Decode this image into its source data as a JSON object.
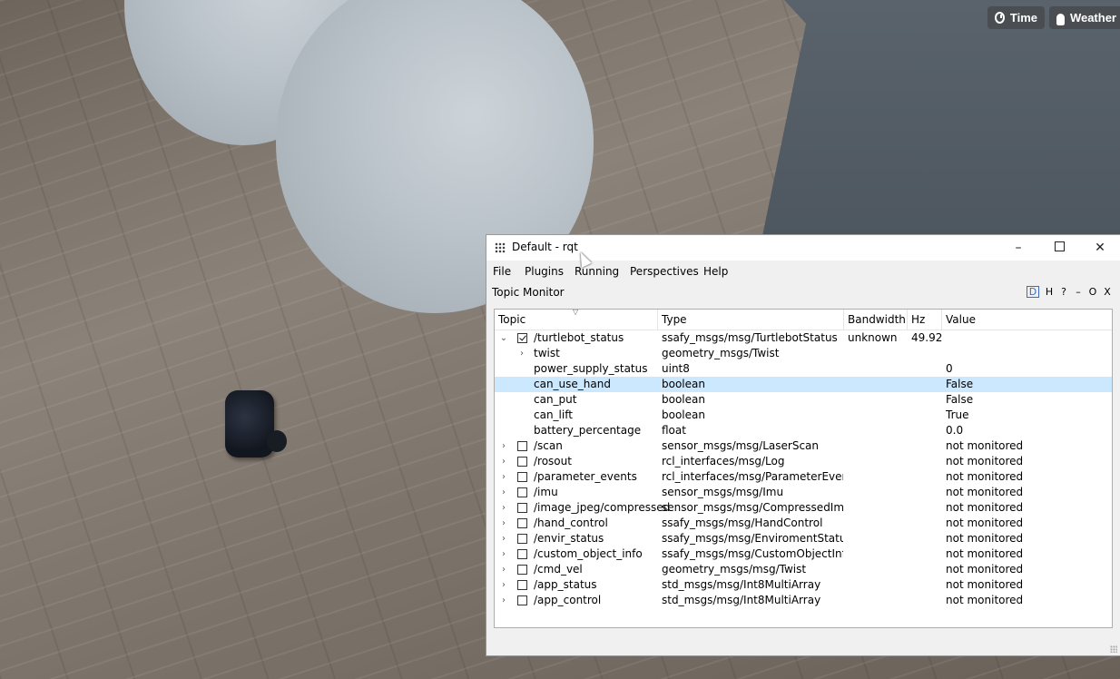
{
  "scene": {
    "buttons": [
      {
        "label": "Time",
        "icon": "clock-icon"
      },
      {
        "label": "Weather",
        "icon": "cloud-icon"
      }
    ]
  },
  "window": {
    "title": "Default - rqt",
    "controls": {
      "minimize": "–",
      "maximize": "",
      "close": "✕"
    }
  },
  "menubar": [
    "File",
    "Plugins",
    "Running",
    "Perspectives",
    "Help"
  ],
  "plugin": {
    "title": "Topic Monitor",
    "controls": [
      "D",
      "H",
      "?",
      "–",
      "O",
      "X"
    ]
  },
  "table": {
    "headers": {
      "topic": "Topic",
      "type": "Type",
      "bandwidth": "Bandwidth",
      "hz": "Hz",
      "value": "Value"
    },
    "rows": [
      {
        "level": 0,
        "expanded": true,
        "checked": true,
        "name": "/turtlebot_status",
        "type": "ssafy_msgs/msg/TurtlebotStatus",
        "bandwidth": "unknown",
        "hz": "49.92",
        "value": ""
      },
      {
        "level": 1,
        "expandable": true,
        "name": "twist",
        "type": "geometry_msgs/Twist",
        "value": ""
      },
      {
        "level": 1,
        "name": "power_supply_status",
        "type": "uint8",
        "value": "0"
      },
      {
        "level": 1,
        "name": "can_use_hand",
        "type": "boolean",
        "value": "False",
        "selected": true
      },
      {
        "level": 1,
        "name": "can_put",
        "type": "boolean",
        "value": "False"
      },
      {
        "level": 1,
        "name": "can_lift",
        "type": "boolean",
        "value": "True"
      },
      {
        "level": 1,
        "name": "battery_percentage",
        "type": "float",
        "value": "0.0"
      },
      {
        "level": 0,
        "checked": false,
        "name": "/scan",
        "type": "sensor_msgs/msg/LaserScan",
        "value": "not monitored"
      },
      {
        "level": 0,
        "checked": false,
        "name": "/rosout",
        "type": "rcl_interfaces/msg/Log",
        "value": "not monitored"
      },
      {
        "level": 0,
        "checked": false,
        "name": "/parameter_events",
        "type": "rcl_interfaces/msg/ParameterEvent",
        "value": "not monitored"
      },
      {
        "level": 0,
        "checked": false,
        "name": "/imu",
        "type": "sensor_msgs/msg/Imu",
        "value": "not monitored"
      },
      {
        "level": 0,
        "checked": false,
        "name": "/image_jpeg/compressed",
        "type": "sensor_msgs/msg/CompressedImage",
        "value": "not monitored"
      },
      {
        "level": 0,
        "checked": false,
        "name": "/hand_control",
        "type": "ssafy_msgs/msg/HandControl",
        "value": "not monitored"
      },
      {
        "level": 0,
        "checked": false,
        "name": "/envir_status",
        "type": "ssafy_msgs/msg/EnviromentStatus",
        "value": "not monitored"
      },
      {
        "level": 0,
        "checked": false,
        "name": "/custom_object_info",
        "type": "ssafy_msgs/msg/CustomObjectInfo",
        "value": "not monitored"
      },
      {
        "level": 0,
        "checked": false,
        "name": "/cmd_vel",
        "type": "geometry_msgs/msg/Twist",
        "value": "not monitored"
      },
      {
        "level": 0,
        "checked": false,
        "name": "/app_status",
        "type": "std_msgs/msg/Int8MultiArray",
        "value": "not monitored"
      },
      {
        "level": 0,
        "checked": false,
        "name": "/app_control",
        "type": "std_msgs/msg/Int8MultiArray",
        "value": "not monitored"
      }
    ]
  }
}
